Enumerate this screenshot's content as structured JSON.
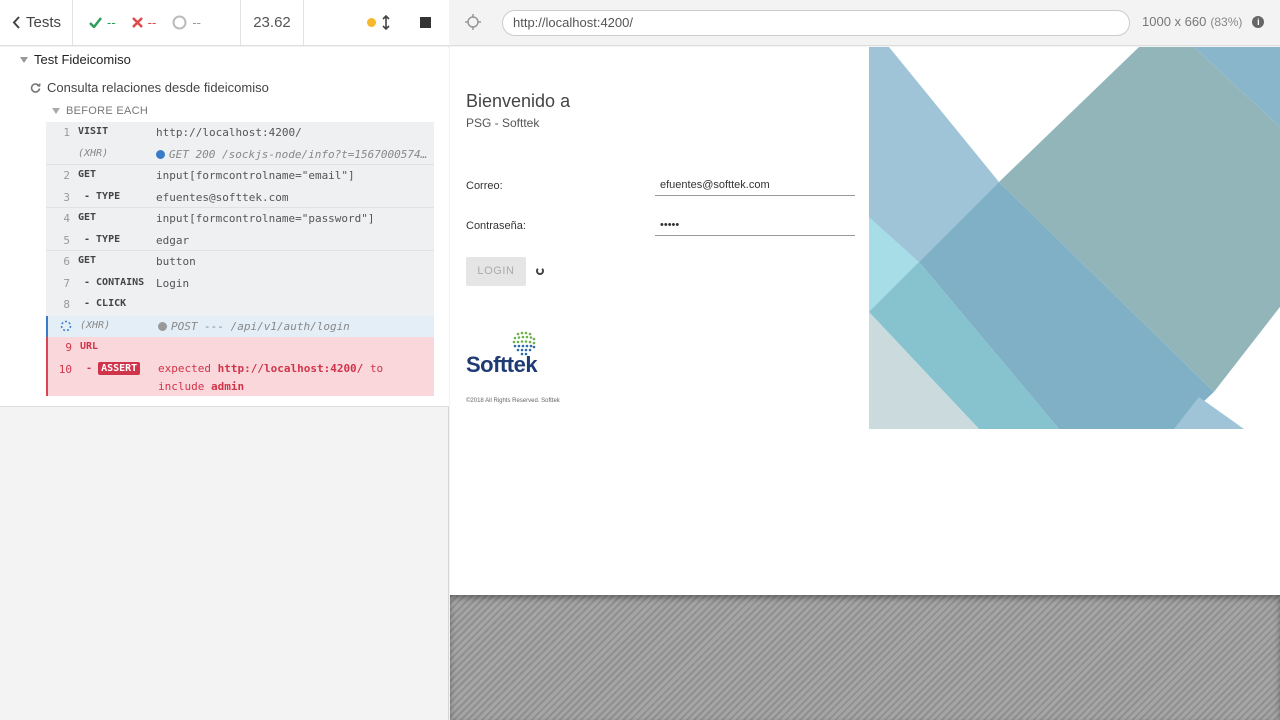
{
  "reporter": {
    "header": {
      "tests_label": "Tests",
      "passed": "--",
      "failed": "--",
      "pending": "--",
      "duration": "23.62"
    },
    "suite_title": "Test Fideicomiso",
    "test_title": "Consulta relaciones desde fideicomiso",
    "hook_title": "BEFORE EACH",
    "commands": [
      {
        "num": "1",
        "name": "VISIT",
        "msg": "http://localhost:4200/"
      },
      {
        "num": "",
        "name": "(XHR)",
        "msg": "GET 200 /sockjs-node/info?t=1567000574…"
      },
      {
        "num": "2",
        "name": "GET",
        "msg": "input[formcontrolname=\"email\"]"
      },
      {
        "num": "3",
        "name": "- TYPE",
        "msg": "efuentes@softtek.com"
      },
      {
        "num": "4",
        "name": "GET",
        "msg": "input[formcontrolname=\"password\"]"
      },
      {
        "num": "5",
        "name": "- TYPE",
        "msg": "edgar"
      },
      {
        "num": "6",
        "name": "GET",
        "msg": "button"
      },
      {
        "num": "7",
        "name": "- CONTAINS",
        "msg": "Login"
      },
      {
        "num": "8",
        "name": "- CLICK",
        "msg": ""
      },
      {
        "num": "",
        "name": "(XHR)",
        "msg": "POST --- /api/v1/auth/login"
      },
      {
        "num": "9",
        "name": "URL",
        "msg": ""
      },
      {
        "num": "10",
        "name_prefix": "-",
        "name": "ASSERT",
        "msg_prefix": "expected",
        "msg_url": "http://localhost:4200/",
        "msg_mid": "to",
        "msg_line2_prefix": "include",
        "msg_expected": "admin"
      }
    ]
  },
  "aut": {
    "url": "http://localhost:4200/",
    "viewport": "1000 x 660",
    "scale": "(83%)",
    "page": {
      "welcome": "Bienvenido a",
      "company": "PSG - Softtek",
      "email_label": "Correo:",
      "email_value": "efuentes@softtek.com",
      "password_label": "Contraseña:",
      "password_value": "•••••",
      "login_button": "LOGIN",
      "logo_text": "Softtek",
      "copyright": "©2018 All Rights Reserved. Softtek"
    }
  },
  "colors": {
    "pass": "#2f9e5b",
    "fail": "#e14848",
    "running": "#f5b72c",
    "xhr_done": "#3a7bc8",
    "xhr_pending": "#999999",
    "brand": "#1f3b74"
  }
}
